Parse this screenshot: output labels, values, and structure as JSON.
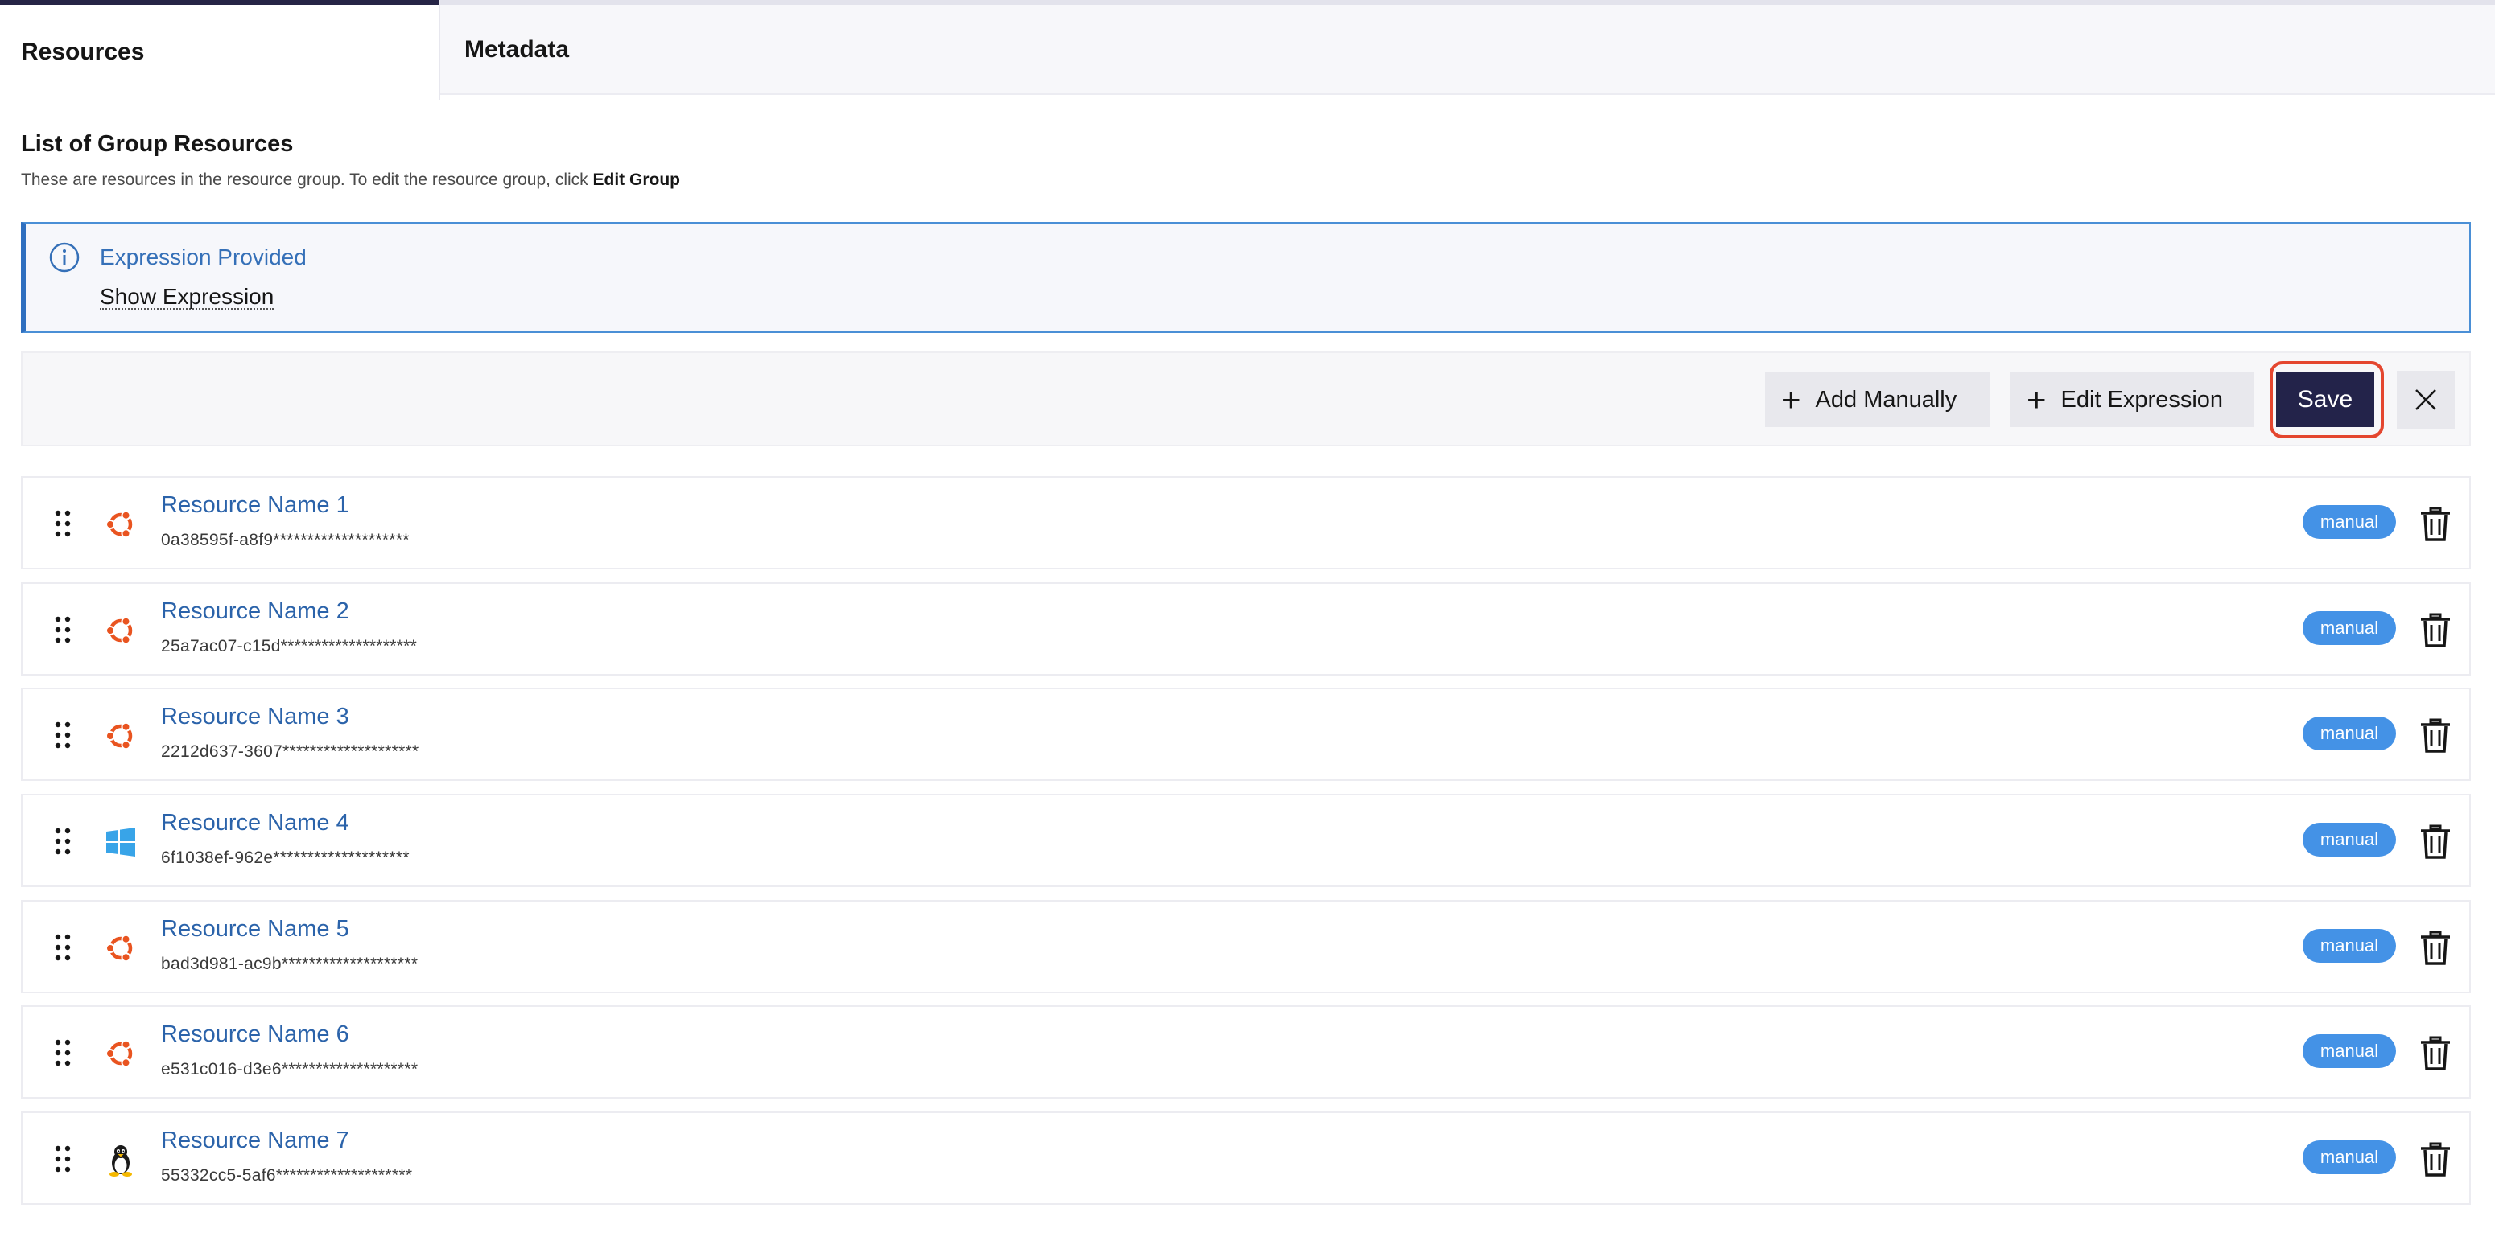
{
  "tabs": [
    {
      "label": "Resources",
      "active": true
    },
    {
      "label": "Metadata",
      "active": false
    }
  ],
  "section": {
    "title": "List of Group Resources",
    "description_prefix": "These are resources in the resource group. To edit the resource group, click ",
    "description_emphasis": "Edit Group"
  },
  "notice": {
    "title": "Expression Provided",
    "link": "Show Expression",
    "icon": "info-icon"
  },
  "toolbar": {
    "add_manually": "Add Manually",
    "edit_expression": "Edit Expression",
    "save": "Save",
    "close_icon": "close-icon"
  },
  "colors": {
    "primary_dark": "#23234a",
    "link_blue": "#2b63aa",
    "badge_blue": "#4492e6",
    "ubuntu_orange": "#e95420",
    "windows_blue": "#38a4e8",
    "highlight_red": "#e4462f"
  },
  "resources": [
    {
      "name": "Resource Name 1",
      "id": "0a38595f-a8f9********************",
      "os": "ubuntu-icon",
      "badge": "manual"
    },
    {
      "name": "Resource Name 2",
      "id": "25a7ac07-c15d********************",
      "os": "ubuntu-icon",
      "badge": "manual"
    },
    {
      "name": "Resource Name 3",
      "id": "2212d637-3607********************",
      "os": "ubuntu-icon",
      "badge": "manual"
    },
    {
      "name": "Resource Name 4",
      "id": "6f1038ef-962e********************",
      "os": "windows-icon",
      "badge": "manual"
    },
    {
      "name": "Resource Name 5",
      "id": "bad3d981-ac9b********************",
      "os": "ubuntu-icon",
      "badge": "manual"
    },
    {
      "name": "Resource Name 6",
      "id": "e531c016-d3e6********************",
      "os": "ubuntu-icon",
      "badge": "manual"
    },
    {
      "name": "Resource Name 7",
      "id": "55332cc5-5af6********************",
      "os": "linux-icon",
      "badge": "manual"
    }
  ]
}
